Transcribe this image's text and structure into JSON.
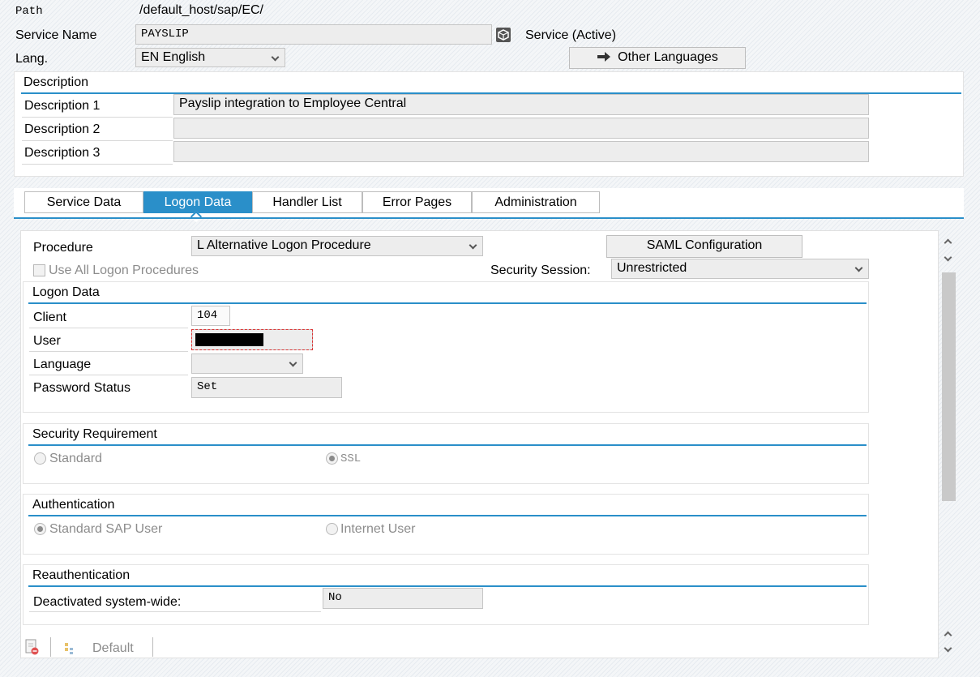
{
  "header": {
    "path_label": "Path",
    "path_value": "/default_host/sap/EC/",
    "service_name_label": "Service Name",
    "service_name_value": "PAYSLIP",
    "service_status": "Service (Active)",
    "lang_label": "Lang.",
    "lang_value": "EN English",
    "other_languages_label": "Other Languages"
  },
  "description": {
    "title": "Description",
    "rows": [
      {
        "label": "Description 1",
        "value": "Payslip integration to Employee Central"
      },
      {
        "label": "Description 2",
        "value": ""
      },
      {
        "label": "Description 3",
        "value": ""
      }
    ]
  },
  "tabs": [
    {
      "label": "Service Data",
      "active": false
    },
    {
      "label": "Logon Data",
      "active": true
    },
    {
      "label": "Handler List",
      "active": false
    },
    {
      "label": "Error Pages",
      "active": false
    },
    {
      "label": "Administration",
      "active": false
    }
  ],
  "logon_tab": {
    "procedure_label": "Procedure",
    "procedure_value": "L Alternative Logon Procedure",
    "saml_button": "SAML Configuration",
    "use_all_label": "Use All Logon Procedures",
    "security_session_label": "Security Session:",
    "security_session_value": "Unrestricted",
    "logon_data": {
      "title": "Logon Data",
      "client_label": "Client",
      "client_value": "104",
      "user_label": "User",
      "user_value": "",
      "language_label": "Language",
      "language_value": "",
      "password_status_label": "Password Status",
      "password_status_value": "Set"
    },
    "security_requirement": {
      "title": "Security Requirement",
      "options": [
        {
          "label": "Standard",
          "selected": false
        },
        {
          "label": "SSL",
          "selected": true
        }
      ]
    },
    "authentication": {
      "title": "Authentication",
      "options": [
        {
          "label": "Standard SAP User",
          "selected": true
        },
        {
          "label": "Internet User",
          "selected": false
        }
      ]
    },
    "reauthentication": {
      "title": "Reauthentication",
      "deactivated_label": "Deactivated system-wide:",
      "deactivated_value": "No"
    }
  },
  "footer_toolbar": {
    "default_label": "Default"
  },
  "colors": {
    "accent": "#2a8fc9",
    "field_bg": "#ededed"
  }
}
